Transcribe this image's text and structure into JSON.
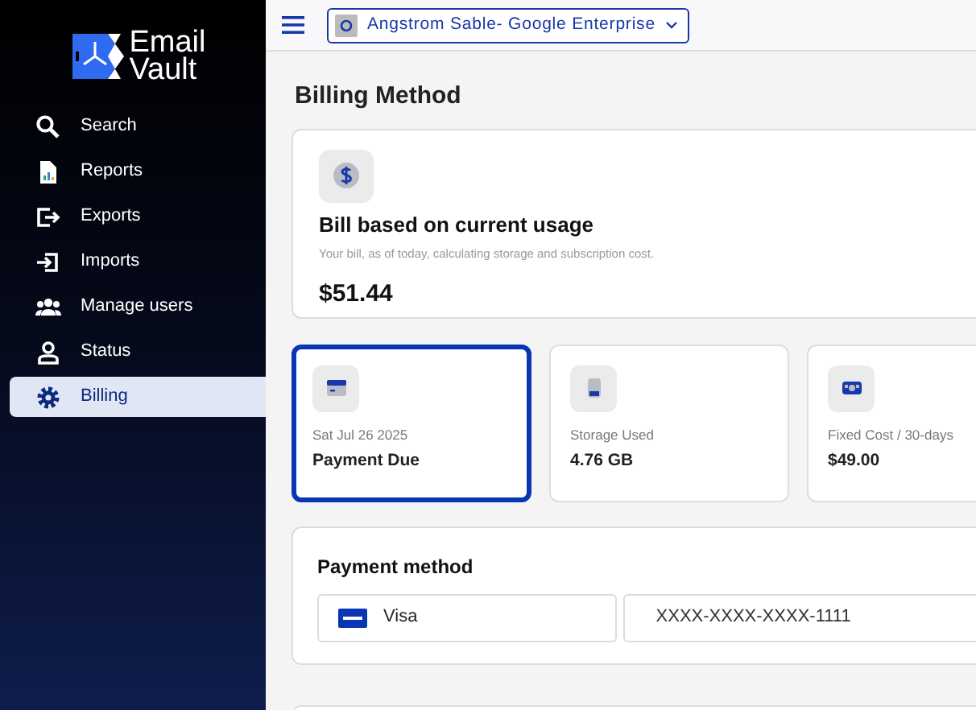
{
  "logo": {
    "line_1": "Email",
    "line_2": "Vault"
  },
  "sidebar": {
    "items": [
      {
        "label": "Search",
        "selected": false
      },
      {
        "label": "Reports",
        "selected": false
      },
      {
        "label": "Exports",
        "selected": false
      },
      {
        "label": "Imports",
        "selected": false
      },
      {
        "label": "Manage users",
        "selected": false
      },
      {
        "label": "Status",
        "selected": false
      },
      {
        "label": "Billing",
        "selected": true
      }
    ]
  },
  "topbar": {
    "account": "Angstrom Sable- Google Enterprise"
  },
  "page_title": "Billing Method",
  "bill": {
    "title": "Bill based on current usage",
    "subtitle": "Your bill, as of today, calculating storage and subscription cost.",
    "amount": "$51.44"
  },
  "stats": [
    {
      "caption": "Sat Jul 26 2025",
      "value": "Payment Due",
      "selected": true
    },
    {
      "caption": "Storage Used",
      "value": "4.76 GB",
      "selected": false
    },
    {
      "caption": "Fixed Cost / 30-days",
      "value": "$49.00",
      "selected": false
    }
  ],
  "payment": {
    "title": "Payment method",
    "brand": "Visa",
    "number": "XXXX-XXXX-XXXX-1111"
  }
}
